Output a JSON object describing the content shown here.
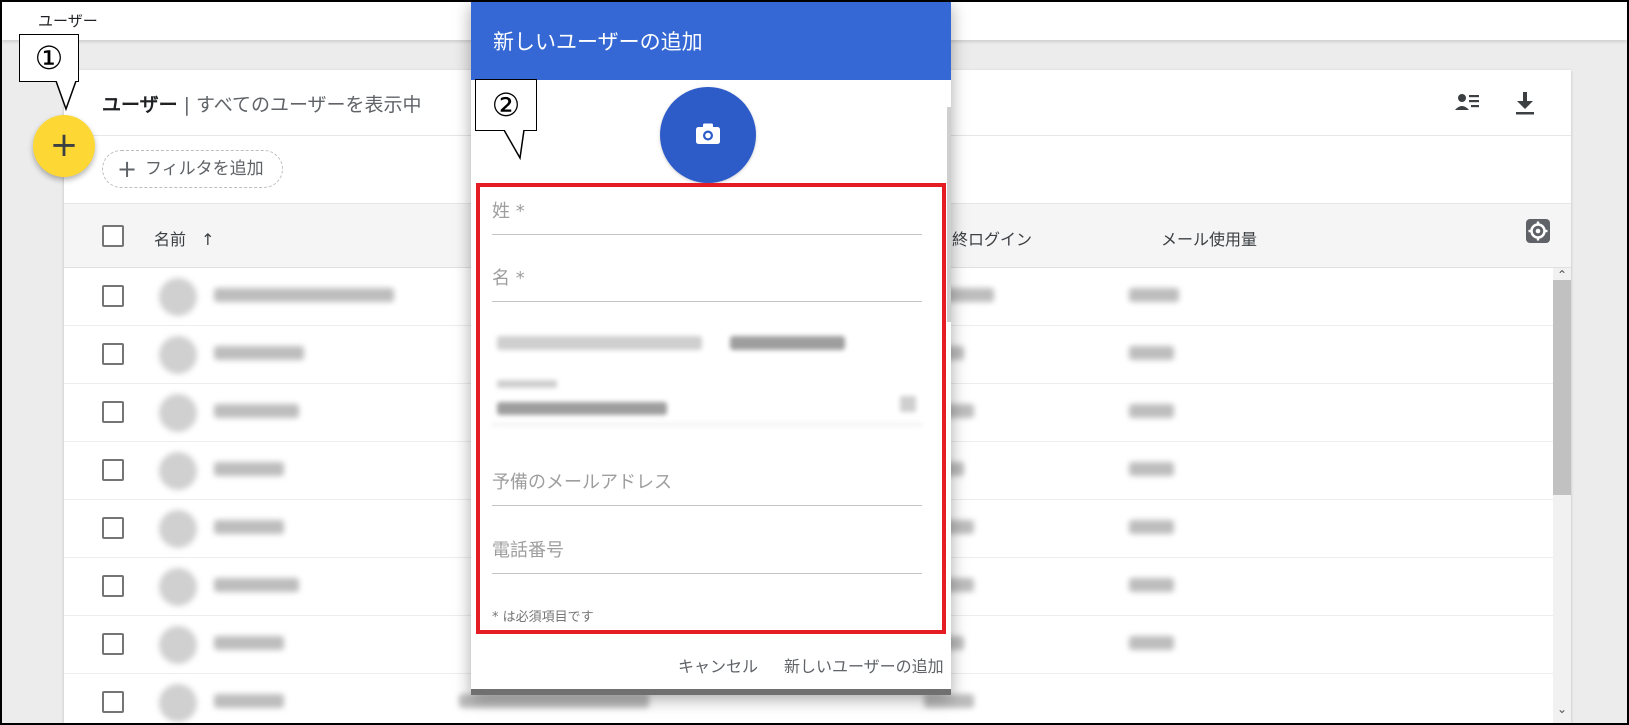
{
  "app": {
    "title": "ユーザー"
  },
  "header": {
    "title_bold": "ユーザー",
    "separator": "|",
    "title_sub": "すべてのユーザーを表示中",
    "icons": [
      "add-person-list-icon",
      "download-icon"
    ]
  },
  "filter": {
    "plus": "+",
    "label": "フィルタを追加"
  },
  "table": {
    "columns": [
      {
        "label": "名前",
        "sort": "↑"
      },
      {
        "label": "終ログイン"
      },
      {
        "label": "メール使用量"
      }
    ],
    "settings_icon": "gear-icon",
    "row_count": 8
  },
  "fab": {
    "label": "+"
  },
  "callouts": {
    "one": "①",
    "two": "②"
  },
  "dialog": {
    "title": "新しいユーザーの追加",
    "camera_icon": "camera-icon",
    "fields": {
      "last_name": "姓 *",
      "first_name": "名 *",
      "backup_email": "予備のメールアドレス",
      "phone": "電話番号"
    },
    "required_note": "* は必須項目です",
    "cancel": "キャンセル",
    "submit": "新しいユーザーの追加"
  },
  "colors": {
    "dialog_header": "#3568d4",
    "camera": "#2d5bc8",
    "fab": "#fdd835",
    "highlight": "#e51c23"
  }
}
